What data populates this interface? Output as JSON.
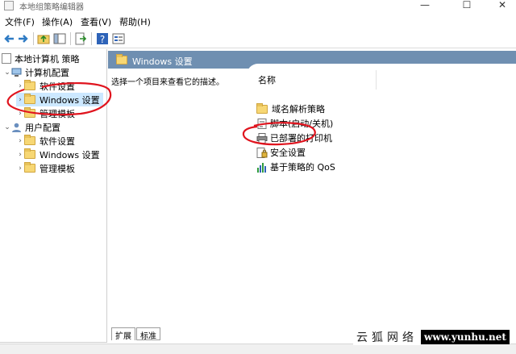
{
  "window": {
    "title": "本地组策略编辑器",
    "controls": [
      "—",
      "☐",
      "✕"
    ]
  },
  "menu": [
    "文件(F)",
    "操作(A)",
    "查看(V)",
    "帮助(H)"
  ],
  "toolbar": {
    "icons": [
      "back-arrow-icon",
      "forward-arrow-icon",
      "up-folder-icon",
      "show-hide-tree-icon",
      "export-list-icon",
      "help-icon",
      "properties-icon"
    ]
  },
  "tree": {
    "root": "本地计算机 策略",
    "computer_config": "计算机配置",
    "cc_software": "软件设置",
    "cc_windows": "Windows 设置",
    "cc_admin": "管理模板",
    "user_config": "用户配置",
    "uc_software": "软件设置",
    "uc_windows": "Windows 设置",
    "uc_admin": "管理模板"
  },
  "details": {
    "header_title": "Windows 设置",
    "description": "选择一个项目来查看它的描述。",
    "column_name": "名称",
    "items": [
      {
        "label": "域名解析策略",
        "icon": "folder-icon"
      },
      {
        "label": "脚本(启动/关机)",
        "icon": "script-icon"
      },
      {
        "label": "已部署的打印机",
        "icon": "printer-icon"
      },
      {
        "label": "安全设置",
        "icon": "security-settings-icon"
      },
      {
        "label": "基于策略的 QoS",
        "icon": "qos-chart-icon"
      }
    ]
  },
  "tabs": [
    "扩展",
    "标准"
  ],
  "watermark": {
    "cn": "云狐网络",
    "url": "www.yunhu.net"
  },
  "colors": {
    "header_bar": "#6f8fb1",
    "annotation": "#e0141e",
    "selection": "#cce8ff"
  }
}
